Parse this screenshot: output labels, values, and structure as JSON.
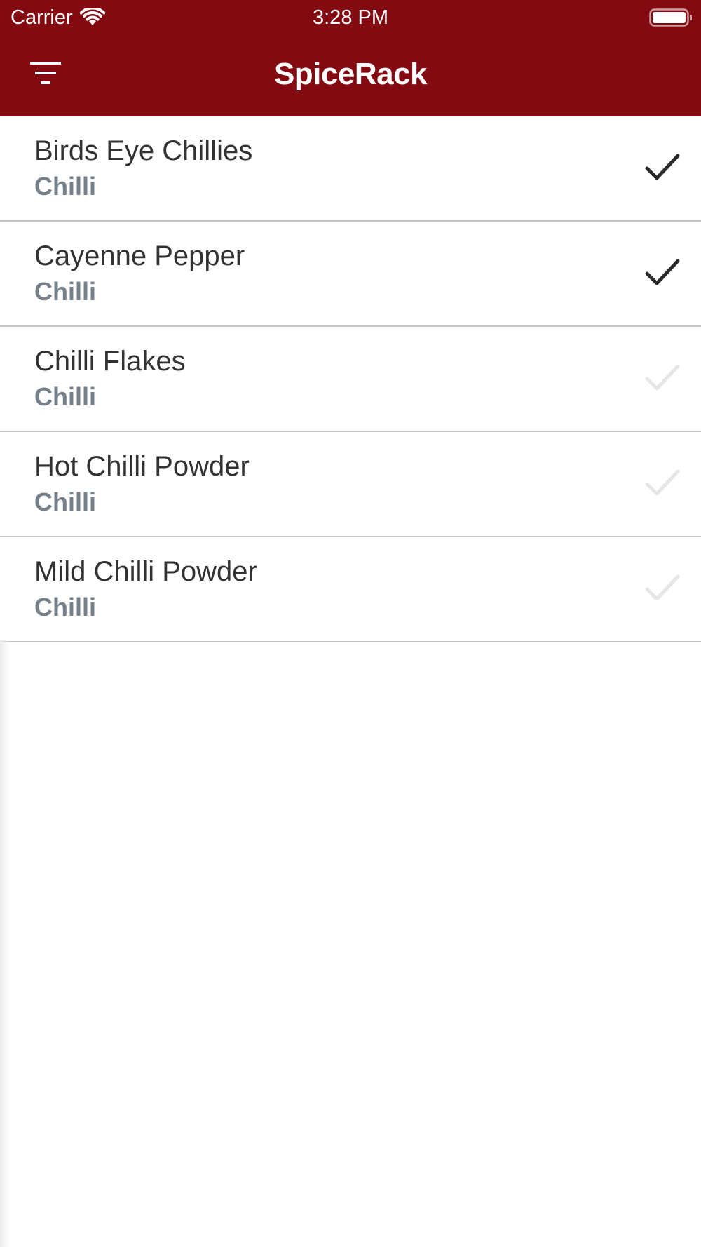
{
  "status_bar": {
    "carrier": "Carrier",
    "time": "3:28 PM",
    "wifi_icon": "wifi-icon",
    "battery_icon": "battery-icon"
  },
  "nav": {
    "title": "SpiceRack",
    "filter_icon": "filter-icon"
  },
  "colors": {
    "header_bg": "#820a10",
    "header_text": "#ffffff",
    "item_text": "#323232",
    "category_text": "#75808a",
    "check_on": "#2b2b2b",
    "check_off": "#e6e6e6",
    "divider": "#c4c4c4"
  },
  "items": [
    {
      "name": "Birds Eye Chillies",
      "category": "Chilli",
      "checked": true
    },
    {
      "name": "Cayenne Pepper",
      "category": "Chilli",
      "checked": true
    },
    {
      "name": "Chilli Flakes",
      "category": "Chilli",
      "checked": false
    },
    {
      "name": "Hot Chilli Powder",
      "category": "Chilli",
      "checked": false
    },
    {
      "name": "Mild Chilli Powder",
      "category": "Chilli",
      "checked": false
    }
  ]
}
